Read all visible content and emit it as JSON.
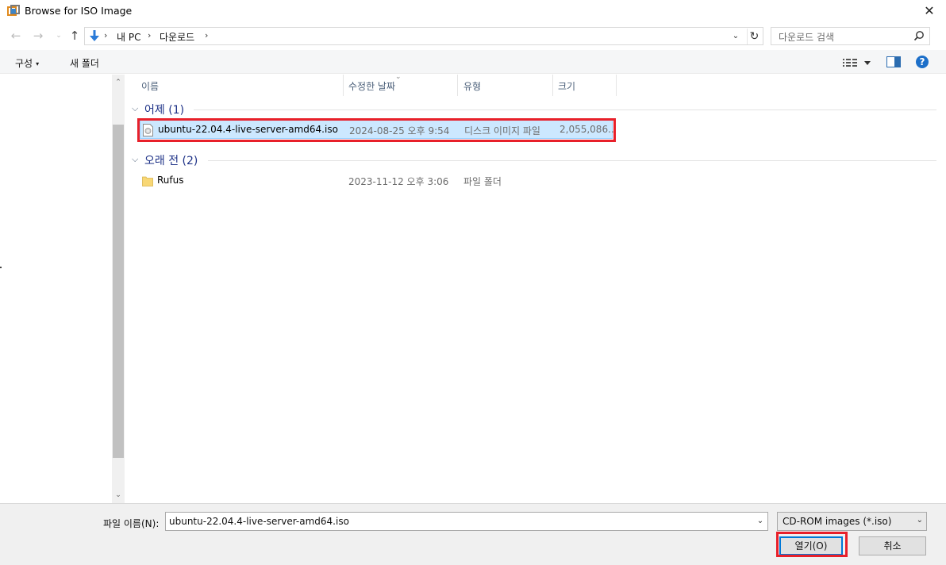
{
  "window": {
    "title": "Browse for ISO Image",
    "close_glyph": "✕"
  },
  "nav": {
    "back_glyph": "←",
    "forward_glyph": "→",
    "recent_glyph": "⌄",
    "up_glyph": "↑"
  },
  "address": {
    "crumbs": [
      "내 PC",
      "다운로드"
    ],
    "separator": "›",
    "dropdown_glyph": "⌄",
    "refresh_glyph": "↻"
  },
  "search": {
    "placeholder": "다운로드 검색"
  },
  "toolbar": {
    "organize_label": "구성",
    "organize_caret": "▾",
    "new_folder_label": "새 폴더",
    "help_label": "?"
  },
  "scrollbar": {
    "up_glyph": "⌃",
    "down_glyph": "⌄"
  },
  "columns": {
    "name": "이름",
    "date": "수정한 날짜",
    "type": "유형",
    "size": "크기",
    "sort_glyph": "⌄"
  },
  "groups": [
    {
      "label": "어제 (1)",
      "chevron": "⌵",
      "files": [
        {
          "name": "ubuntu-22.04.4-live-server-amd64.iso",
          "date": "2024-08-25 오후 9:54",
          "type": "디스크 이미지 파일",
          "size": "2,055,086...",
          "icon": "disc-image-file-icon",
          "selected": true
        }
      ]
    },
    {
      "label": "오래 전 (2)",
      "chevron": "⌵",
      "files": [
        {
          "name": "Rufus",
          "date": "2023-11-12 오후 3:06",
          "type": "파일 폴더",
          "size": "",
          "icon": "folder-icon",
          "selected": false
        }
      ]
    }
  ],
  "footer": {
    "filename_label": "파일 이름(N):",
    "filename_value": "ubuntu-22.04.4-live-server-amd64.iso",
    "filetype_value": "CD-ROM images (*.iso)",
    "dropdown_glyph": "⌄",
    "open_label": "열기(O)",
    "cancel_label": "취소"
  },
  "colors": {
    "selection_bg": "#cce8ff",
    "selection_border": "#99d1ff",
    "highlight_annotation": "#e8202a",
    "group_header": "#1e3287",
    "accent_blue": "#0078d7"
  }
}
